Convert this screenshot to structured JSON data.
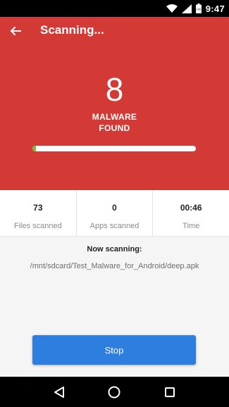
{
  "status_bar": {
    "time": "9:47",
    "icons": [
      "wifi-icon",
      "signal-icon",
      "battery-icon"
    ]
  },
  "header": {
    "title": "Scanning...",
    "back_icon": "arrow-left-icon",
    "malware_count": "8",
    "status_line1": "MALWARE",
    "status_line2": "FOUND",
    "progress_fraction": 0.02,
    "background_color": "#d33a36"
  },
  "stats": [
    {
      "value": "73",
      "label": "Files scanned"
    },
    {
      "value": "0",
      "label": "Apps scanned"
    },
    {
      "value": "00:46",
      "label": "Time"
    }
  ],
  "scan": {
    "title": "Now scanning:",
    "path": "/mnt/sdcard/Test_Malware_for_Android/deep.apk"
  },
  "actions": {
    "stop_label": "Stop",
    "stop_color": "#2e7ee0"
  },
  "nav": {
    "icons": [
      "back-triangle-icon",
      "home-circle-icon",
      "recents-square-icon"
    ]
  }
}
